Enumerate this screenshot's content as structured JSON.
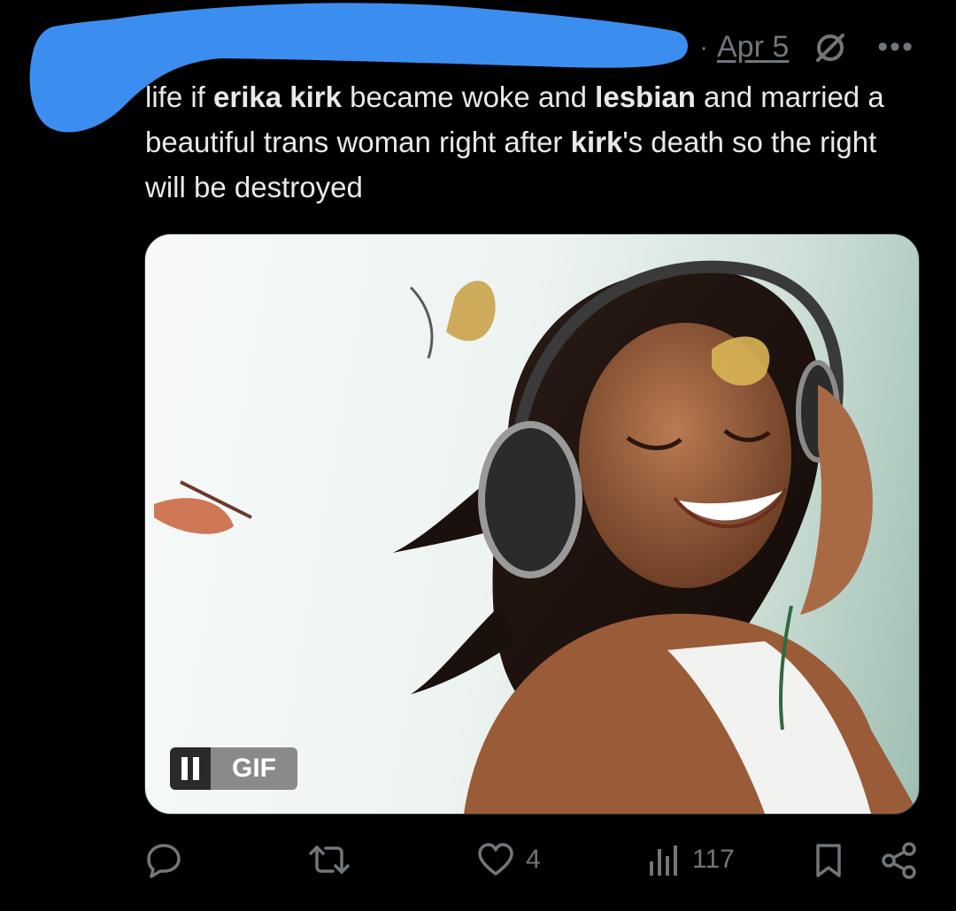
{
  "tweet": {
    "date": "Apr 5",
    "separator": "·",
    "more": "•••",
    "text_parts": [
      {
        "text": "life if ",
        "bold": false
      },
      {
        "text": "erika kirk",
        "bold": true
      },
      {
        "text": " became woke and ",
        "bold": false
      },
      {
        "text": "lesbian",
        "bold": true
      },
      {
        "text": " and married a beautiful trans woman right after ",
        "bold": false
      },
      {
        "text": "kirk",
        "bold": true
      },
      {
        "text": "'s death so the right will be destroyed",
        "bold": false
      }
    ]
  },
  "media": {
    "type": "GIF",
    "badge_label": "GIF",
    "pause_icon": "pause-icon"
  },
  "actions": {
    "reply_count": "",
    "retweet_count": "",
    "like_count": "4",
    "views_count": "117"
  },
  "colors": {
    "background": "#000000",
    "text": "#e7e9ea",
    "muted": "#71767b",
    "redaction": "#3b8ef0"
  }
}
